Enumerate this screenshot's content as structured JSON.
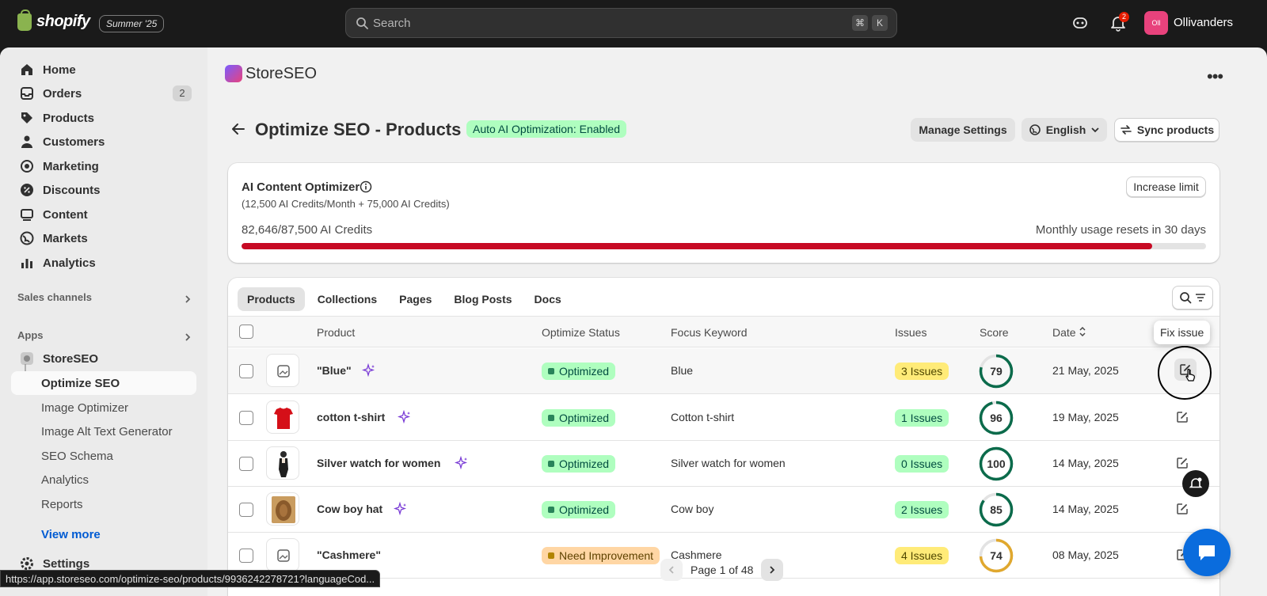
{
  "topbar": {
    "brand": "shopify",
    "edition": "Summer '25",
    "search_placeholder": "Search",
    "shortcut_keys": [
      "⌘",
      "K"
    ],
    "notification_count": "2",
    "store_initials": "Oll",
    "store_name": "Ollivanders"
  },
  "sidebar": {
    "items": [
      {
        "label": "Home",
        "icon": "home-icon"
      },
      {
        "label": "Orders",
        "icon": "orders-icon",
        "count": "2"
      },
      {
        "label": "Products",
        "icon": "tag-icon"
      },
      {
        "label": "Customers",
        "icon": "person-icon"
      },
      {
        "label": "Marketing",
        "icon": "target-icon"
      },
      {
        "label": "Discounts",
        "icon": "discount-icon"
      },
      {
        "label": "Content",
        "icon": "content-icon"
      },
      {
        "label": "Markets",
        "icon": "globe-icon"
      },
      {
        "label": "Analytics",
        "icon": "chart-icon"
      }
    ],
    "sales_channels": "Sales channels",
    "apps": "Apps",
    "app_name": "StoreSEO",
    "sub_items": [
      "Optimize SEO",
      "Image Optimizer",
      "Image Alt Text Generator",
      "SEO Schema",
      "Analytics",
      "Reports"
    ],
    "view_more": "View more",
    "settings": "Settings"
  },
  "header": {
    "app_name": "StoreSEO",
    "page_title": "Optimize SEO - Products",
    "status_badge": "Auto AI Optimization: Enabled",
    "manage_settings": "Manage Settings",
    "language": "English",
    "sync": "Sync products"
  },
  "ai_card": {
    "title": "AI Content Optimizer",
    "subtitle": "(12,500 AI Credits/Month + 75,000 AI Credits)",
    "increase_limit": "Increase limit",
    "credits": "82,646/87,500 AI Credits",
    "reset": "Monthly usage resets in 30 days",
    "usage_fraction": 0.9445,
    "bar_color": "#c70a24"
  },
  "table": {
    "tabs": [
      "Products",
      "Collections",
      "Pages",
      "Blog Posts",
      "Docs"
    ],
    "columns": [
      "Product",
      "Optimize Status",
      "Focus Keyword",
      "Issues",
      "Score",
      "Date"
    ],
    "rows": [
      {
        "product": "\"Blue\"",
        "status": "Optimized",
        "keyword": "Blue",
        "issues": "3 Issues",
        "score": "79",
        "date": "21 May, 2025"
      },
      {
        "product": "cotton t-shirt",
        "status": "Optimized",
        "keyword": "Cotton t-shirt",
        "issues": "1 Issues",
        "score": "96",
        "date": "19 May, 2025"
      },
      {
        "product": "Silver watch for women",
        "status": "Optimized",
        "keyword": "Silver watch for women",
        "issues": "0 Issues",
        "score": "100",
        "date": "14 May, 2025"
      },
      {
        "product": "Cow boy hat",
        "status": "Optimized",
        "keyword": "Cow boy",
        "issues": "2 Issues",
        "score": "85",
        "date": "14 May, 2025"
      },
      {
        "product": "\"Cashmere\"",
        "status": "Need Improvement",
        "keyword": "Cashmere",
        "issues": "4 Issues",
        "score": "74",
        "date": "08 May, 2025"
      }
    ],
    "tooltip": "Fix issue",
    "pagination": "Page 1 of 48"
  },
  "status_url": "https://app.storeseo.com/optimize-seo/products/9936242278721?languageCod..."
}
